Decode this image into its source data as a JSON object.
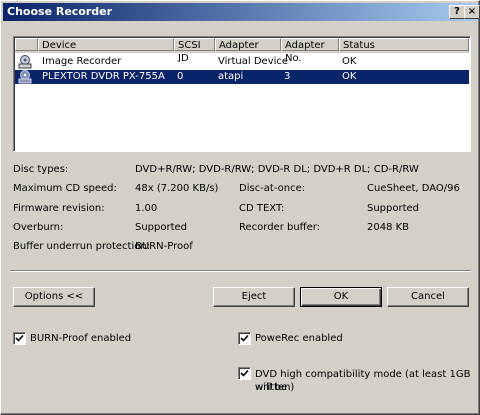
{
  "window": {
    "title": "Choose Recorder",
    "help_label": "?",
    "close_label": "×"
  },
  "list": {
    "columns": [
      "Device",
      "SCSI ID",
      "Adapter",
      "Adapter No.",
      "Status"
    ],
    "rows": [
      {
        "device": "Image Recorder",
        "scsi_id": "-",
        "adapter": "Virtual Device",
        "adapter_no": "-",
        "status": "OK",
        "icon": "image-recorder-icon",
        "selected": false
      },
      {
        "device": "PLEXTOR  DVDR   PX-755A",
        "scsi_id": "0",
        "adapter": "atapi",
        "adapter_no": "3",
        "status": "OK",
        "icon": "dvd-drive-icon",
        "selected": true
      }
    ]
  },
  "info": {
    "disc_types_label": "Disc types:",
    "disc_types_value": "DVD+R/RW; DVD-R/RW; DVD-R DL; DVD+R DL; CD-R/RW",
    "max_speed_label": "Maximum CD speed:",
    "max_speed_value": "48x (7.200 KB/s)",
    "disc_at_once_label": "Disc-at-once:",
    "disc_at_once_value": "CueSheet, DAO/96",
    "firmware_label": "Firmware revision:",
    "firmware_value": "1.00",
    "cd_text_label": "CD TEXT:",
    "cd_text_value": "Supported",
    "overburn_label": "Overburn:",
    "overburn_value": "Supported",
    "buffer_label": "Recorder buffer:",
    "buffer_value": "2048 KB",
    "underrun_label": "Buffer underrun protection:",
    "underrun_value": "BURN-Proof"
  },
  "buttons": {
    "options": "Options <<",
    "eject": "Eject",
    "ok": "OK",
    "cancel": "Cancel"
  },
  "options": {
    "burnproof": {
      "label": "BURN-Proof enabled",
      "checked": true
    },
    "powerec": {
      "label": "PoweRec enabled",
      "checked": true
    },
    "dvd_compat": {
      "label_line1": "DVD high compatibility mode (at least 1GB will be",
      "label_line2": "written)",
      "checked": true
    }
  }
}
